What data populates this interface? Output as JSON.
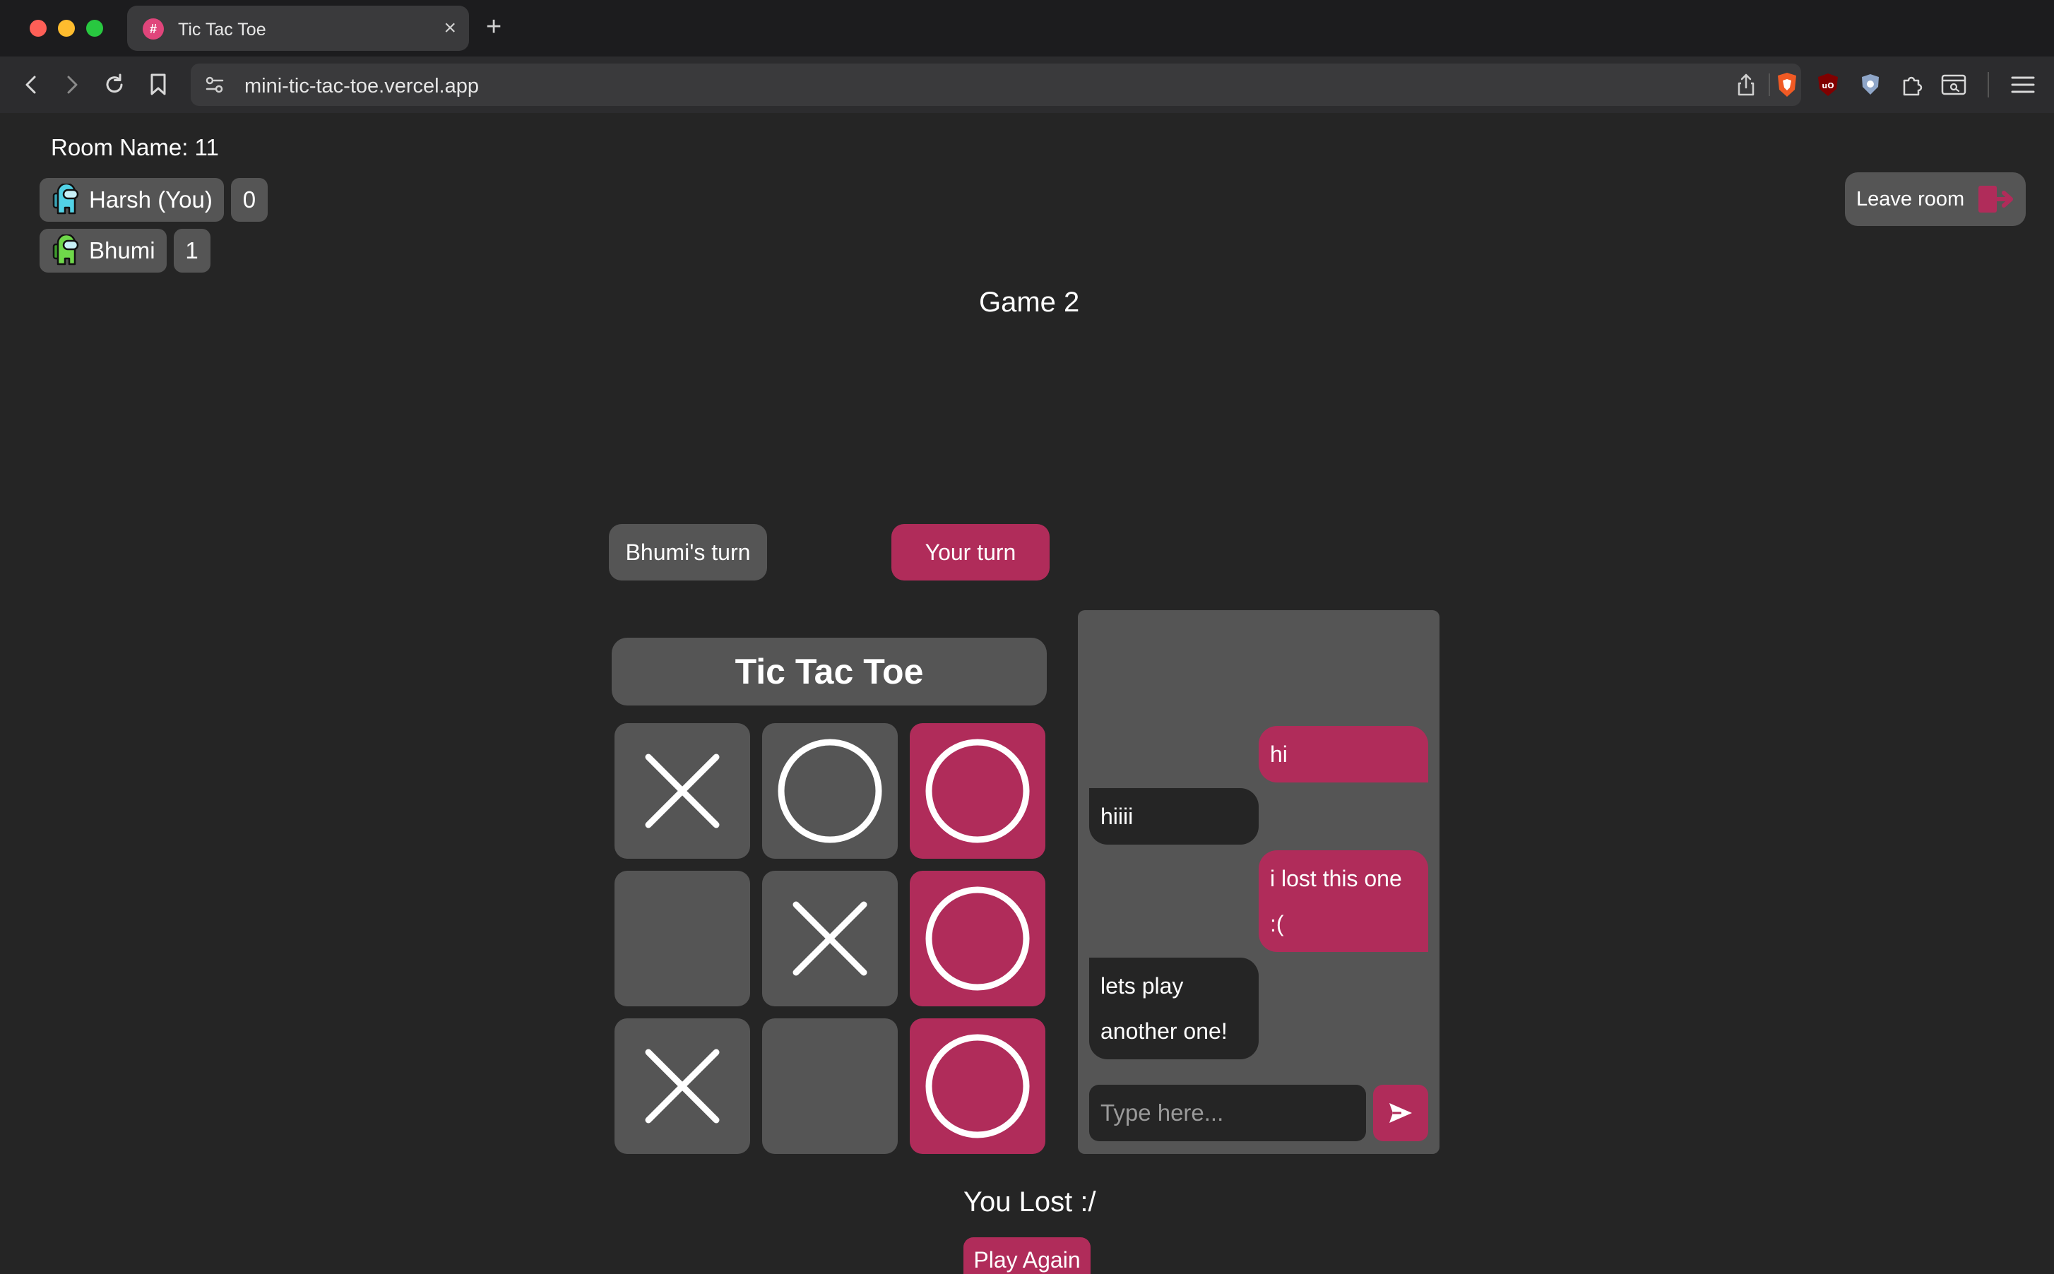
{
  "browser": {
    "tab_title": "Tic Tac Toe",
    "favicon_glyph": "#",
    "new_tab_label": "+",
    "tab_close_label": "×",
    "url": "mini-tic-tac-toe.vercel.app"
  },
  "room": {
    "label": "Room Name: 11"
  },
  "players": [
    {
      "name": "Harsh (You)",
      "score": "0",
      "avatar_color": "#52d2e6"
    },
    {
      "name": "Bhumi",
      "score": "1",
      "avatar_color": "#6fd84a"
    }
  ],
  "leave_button": {
    "label": "Leave room",
    "icon": "exit-icon"
  },
  "game": {
    "title": "Game 2",
    "turn_other": "Bhumi's turn",
    "turn_you": "Your turn",
    "board_title": "Tic Tac Toe",
    "cells": [
      "X",
      "O",
      "O",
      "",
      "X",
      "O",
      "X",
      "",
      "O"
    ],
    "winning_cells": [
      2,
      5,
      8
    ],
    "result": "You Lost :/",
    "play_again": "Play Again"
  },
  "chat": {
    "messages": [
      {
        "from": "me",
        "lines": [
          "hi"
        ]
      },
      {
        "from": "them",
        "lines": [
          "hiiii"
        ]
      },
      {
        "from": "me",
        "lines": [
          "i lost this one",
          ":("
        ]
      },
      {
        "from": "them",
        "lines": [
          "lets play",
          "another one!"
        ]
      }
    ],
    "input_placeholder": "Type here...",
    "send_icon": "send-icon"
  },
  "colors": {
    "accent": "#b02c5a",
    "surface": "#555555",
    "background": "#252525"
  }
}
